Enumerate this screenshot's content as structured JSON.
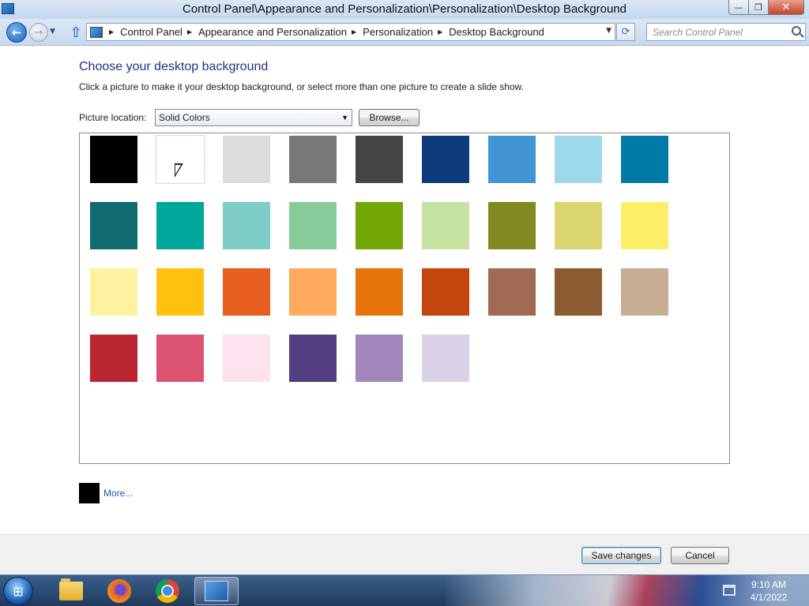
{
  "window": {
    "title": "Control Panel\\Appearance and Personalization\\Personalization\\Desktop Background",
    "buttons": {
      "min": "—",
      "max": "❐",
      "close": "✕"
    }
  },
  "nav": {
    "back_icon": "arrow-left-icon",
    "forward_icon": "arrow-right-icon",
    "breadcrumbs": [
      "Control Panel",
      "Appearance and Personalization",
      "Personalization",
      "Desktop Background"
    ],
    "search_placeholder": "Search Control Panel"
  },
  "content": {
    "heading": "Choose your desktop background",
    "instruction": "Click a picture to make it your desktop background, or select more than one picture to create a slide show.",
    "picture_location_label": "Picture location:",
    "picture_location_value": "Solid Colors",
    "browse_label": "Browse...",
    "colors": [
      [
        "#000000",
        "#ffffff",
        "#dcdcdc",
        "#787878",
        "#444444",
        "#0d3a7c",
        "#4394d4",
        "#9ad8ea",
        "#0079a6"
      ],
      [
        "#0f6b6e",
        "#00a79b",
        "#7ecdc8",
        "#88cc9c",
        "#72a605",
        "#c7e3a1",
        "#818921",
        "#dad56f",
        "#fdee67"
      ],
      [
        "#fdf2a0",
        "#ffc10f",
        "#e85e1e",
        "#ffaa5c",
        "#e6740b",
        "#c3440d",
        "#a16b53",
        "#8b5c32",
        "#c8ad95"
      ],
      [
        "#bb2633",
        "#db5371",
        "#fde1ef",
        "#543e82",
        "#a287bd",
        "#dad1e6"
      ]
    ],
    "more_label": "More...",
    "more_color": "#000000"
  },
  "footer": {
    "save_label": "Save changes",
    "cancel_label": "Cancel"
  },
  "taskbar": {
    "items": [
      "start-orb-icon",
      "file-explorer-icon",
      "firefox-icon",
      "chrome-icon",
      "control-panel-icon"
    ],
    "time": "9:10 AM",
    "date": "4/1/2022"
  }
}
